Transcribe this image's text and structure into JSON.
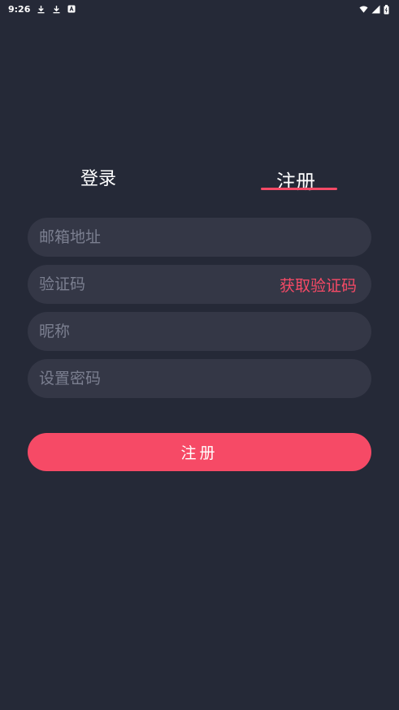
{
  "status_bar": {
    "time": "9:26",
    "left_icons": [
      "download-icon",
      "download-icon",
      "app-notification-icon"
    ],
    "right_icons": [
      "wifi-icon",
      "signal-icon",
      "battery-icon"
    ]
  },
  "tabs": {
    "login": "登录",
    "register": "注册",
    "active": "register"
  },
  "form": {
    "email_placeholder": "邮箱地址",
    "code_placeholder": "验证码",
    "get_code_label": "获取验证码",
    "nickname_placeholder": "昵称",
    "password_placeholder": "设置密码",
    "submit_label": "注册"
  },
  "colors": {
    "background": "#252937",
    "field_background": "#343746",
    "accent": "#f64a66",
    "placeholder": "#7b7f90"
  }
}
